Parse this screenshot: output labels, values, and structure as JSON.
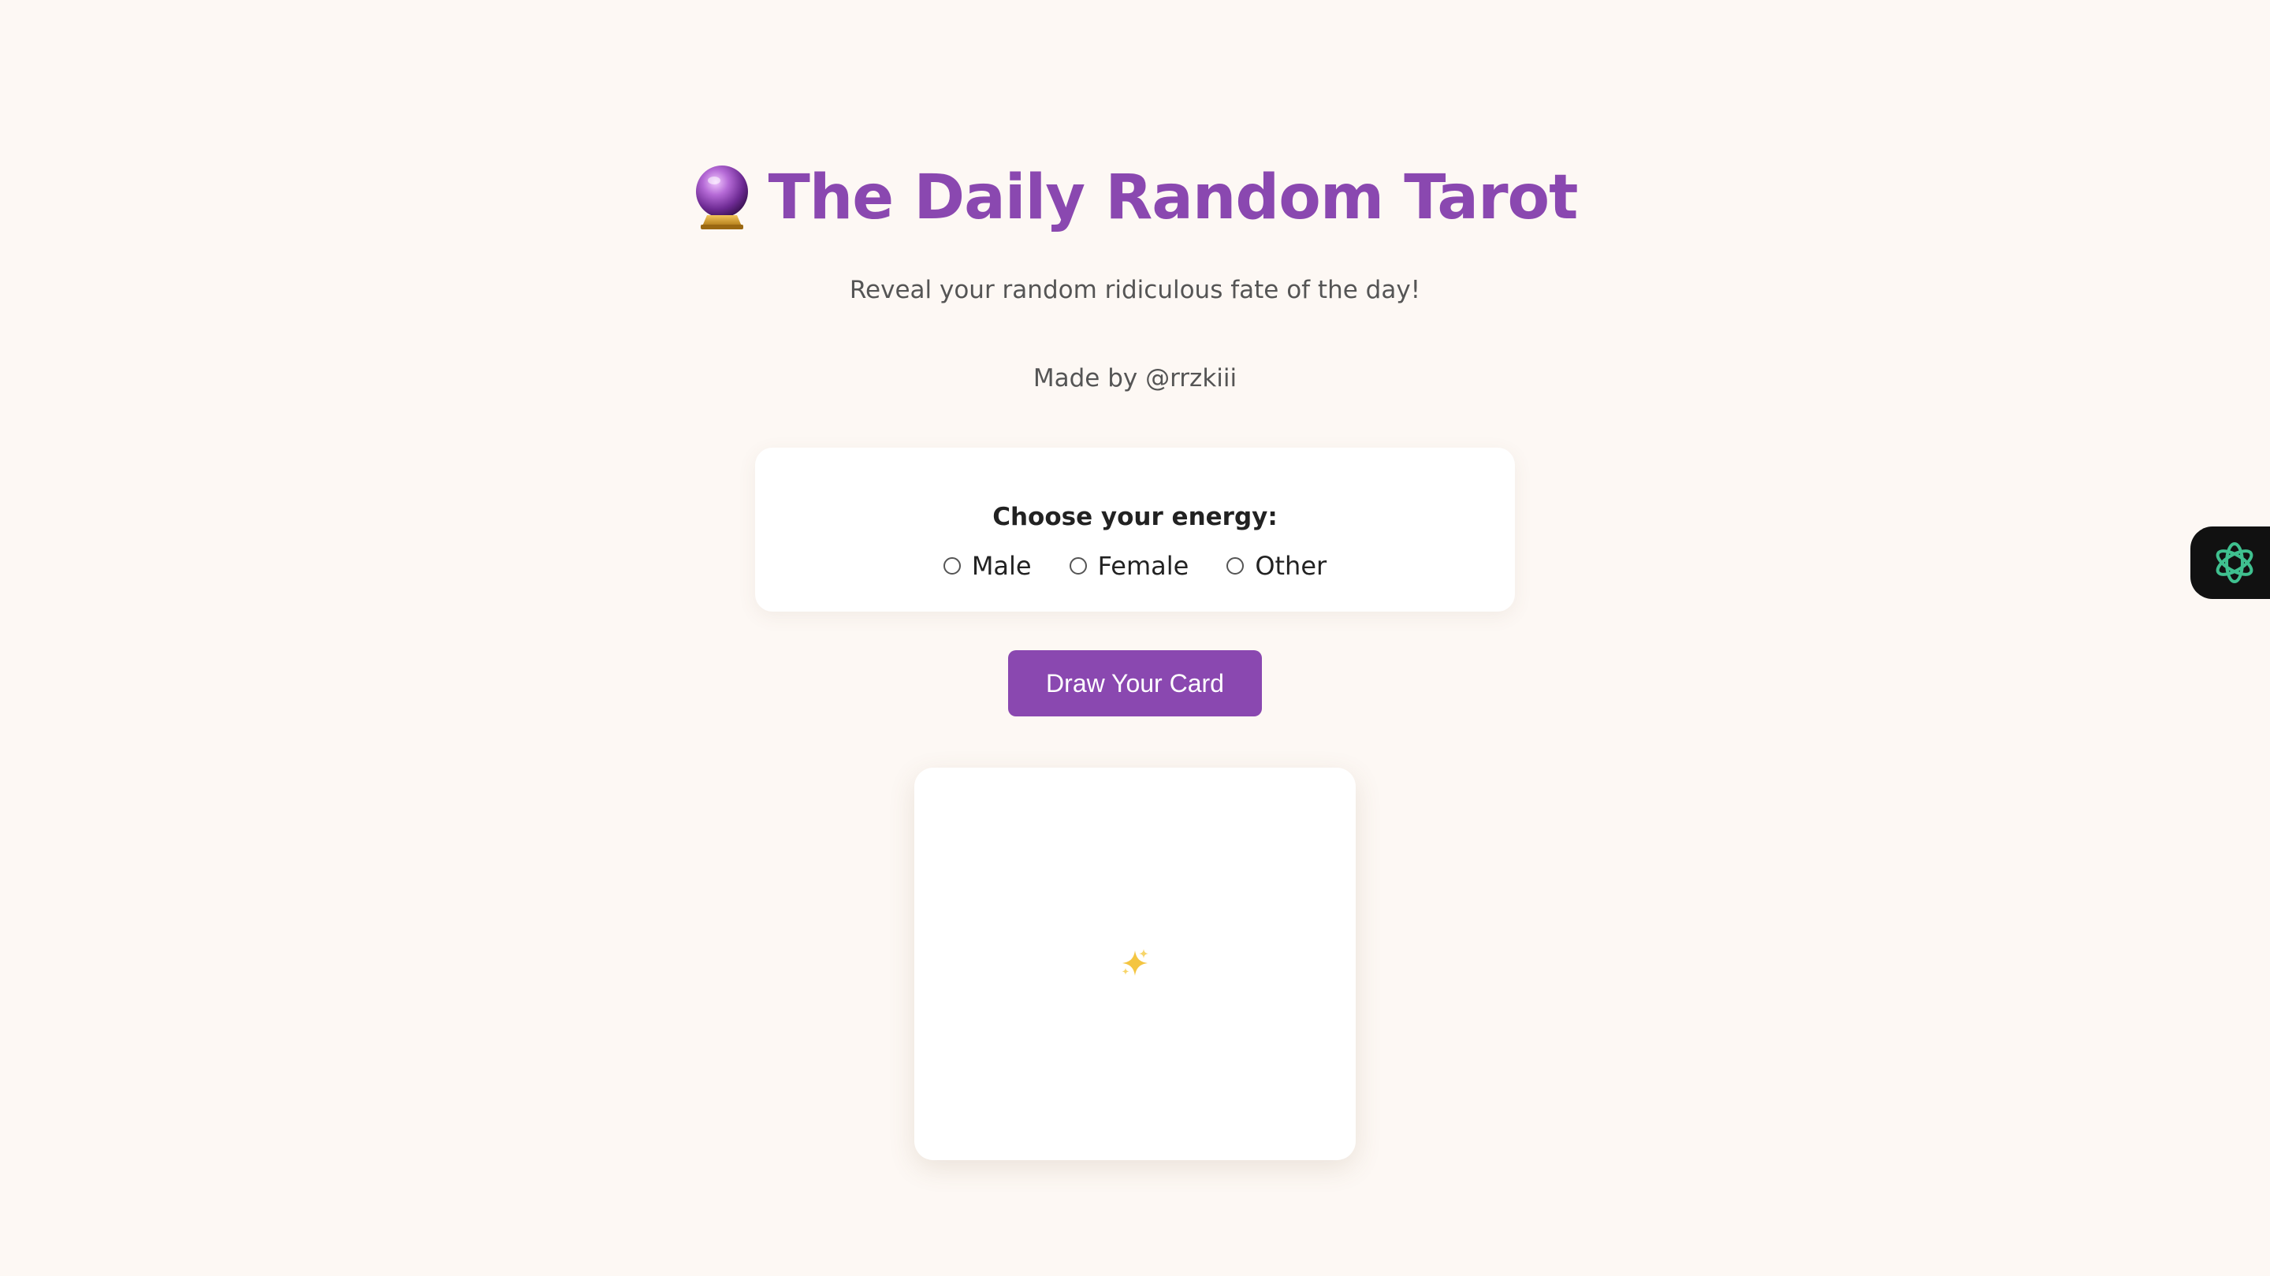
{
  "header": {
    "title": "The Daily Random Tarot",
    "title_icon": "crystal-ball-icon",
    "subtitle": "Reveal your random ridiculous fate of the day!",
    "credit": "Made by @rrzkiii"
  },
  "energy": {
    "label": "Choose your energy:",
    "options": [
      {
        "label": "Male",
        "selected": false
      },
      {
        "label": "Female",
        "selected": false
      },
      {
        "label": "Other",
        "selected": false
      }
    ]
  },
  "draw_button": {
    "label": "Draw Your Card"
  },
  "result": {
    "icon": "sparkles-icon"
  },
  "assistant": {
    "icon": "openai-logo-icon"
  },
  "colors": {
    "background": "#fdf8f4",
    "accent": "#8a48b0",
    "card": "#ffffff",
    "assistant_tab": "#111111",
    "assistant_icon": "#3fc08f"
  }
}
